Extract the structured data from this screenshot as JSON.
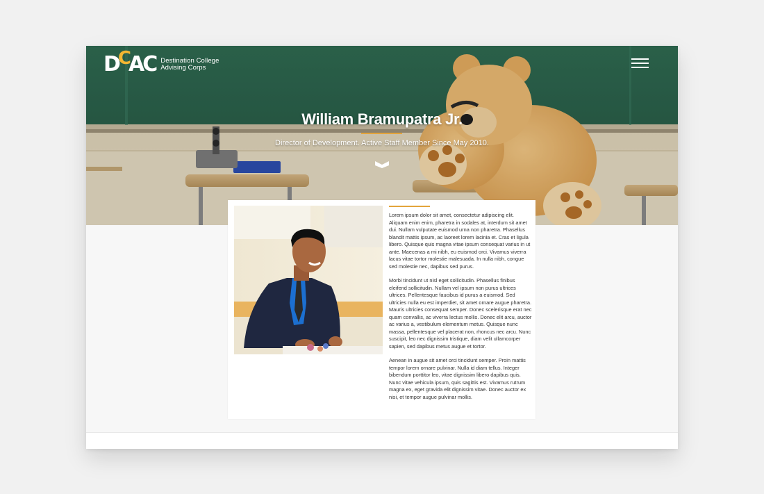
{
  "brand": {
    "logo_mark_left": "D",
    "logo_mark_o": "C",
    "logo_mark_right": "AC",
    "name_line1": "Destination College",
    "name_line2": "Advising Corps",
    "accent_color": "#e3a43b",
    "logo_accent_color": "#f2b632"
  },
  "header": {
    "menu_icon": "hamburger-menu-icon"
  },
  "hero": {
    "title": "William Bramupatra Jr.",
    "subtitle": "Director of Development. Active Staff Member Since May 2010.",
    "scroll_icon": "chevron-down-icon"
  },
  "profile": {
    "photo": "portrait-photo",
    "bio": [
      "Lorem ipsum dolor sit amet, consectetur adipiscing elit. Aliquam enim enim, pharetra in sodales at, interdum sit amet dui. Nullam vulputate euismod urna non pharetra. Phasellus blandit mattis ipsum, ac laoreet lorem lacinia et. Cras et ligula libero. Quisque quis magna vitae ipsum consequat varius in ut ante. Maecenas a mi nibh, eu euismod orci. Vivamus viverra lacus vitae tortor molestie malesuada. In nulla nibh, congue sed molestie nec, dapibus sed purus.",
      "Morbi tincidunt ut nisl eget sollicitudin. Phasellus finibus eleifend sollicitudin. Nullam vel ipsum non purus ultrices ultrices. Pellentesque faucibus id purus a euismod. Sed ultricies nulla eu est imperdiet, sit amet ornare augue pharetra. Mauris ultricies consequat semper. Donec scelerisque erat nec quam convallis, ac viverra lectus mollis. Donec elit arcu, auctor ac varius a, vestibulum elementum metus. Quisque nunc massa, pellentesque vel placerat non, rhoncus nec arcu. Nunc suscipit, leo nec dignissim tristique, diam velit ullamcorper sapien, sed dapibus metus augue et tortor.",
      "Aenean in augue sit amet orci tincidunt semper. Proin mattis tempor lorem ornare pulvinar. Nulla id diam tellus. Integer bibendum porttitor leo, vitae dignissim libero dapibus quis. Nunc vitae vehicula ipsum, quis sagittis est. Vivamus rutrum magna ex, eget gravida elit dignissim vitae. Donec auctor ex nisi, et tempor augue pulvinar mollis."
    ]
  }
}
